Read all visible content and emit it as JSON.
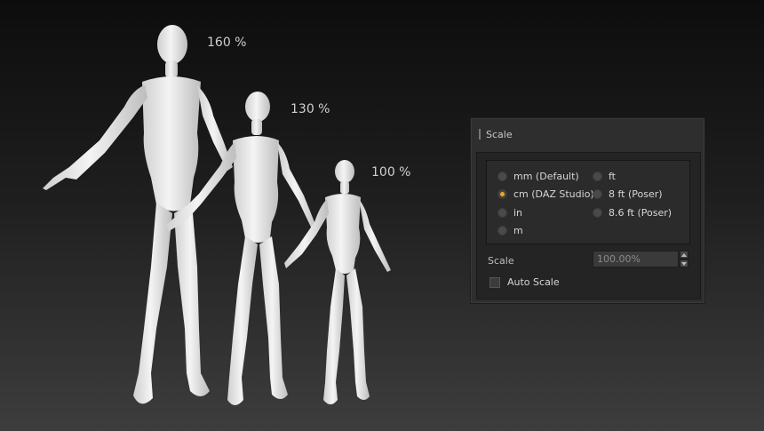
{
  "figures": {
    "large_label": "160 %",
    "medium_label": "130 %",
    "small_label": "100 %"
  },
  "panel": {
    "title": "Scale",
    "units": [
      {
        "label": "mm (Default)",
        "checked": false
      },
      {
        "label": "cm (DAZ Studio)",
        "checked": true
      },
      {
        "label": "in",
        "checked": false
      },
      {
        "label": "m",
        "checked": false
      },
      {
        "label": "ft",
        "checked": false
      },
      {
        "label": "8 ft (Poser)",
        "checked": false
      },
      {
        "label": "8.6 ft (Poser)",
        "checked": false
      }
    ],
    "scale_label": "Scale",
    "scale_value": "100.00%",
    "auto_scale_label": "Auto Scale",
    "auto_scale_checked": false,
    "accent_color": "#f2a51c"
  }
}
